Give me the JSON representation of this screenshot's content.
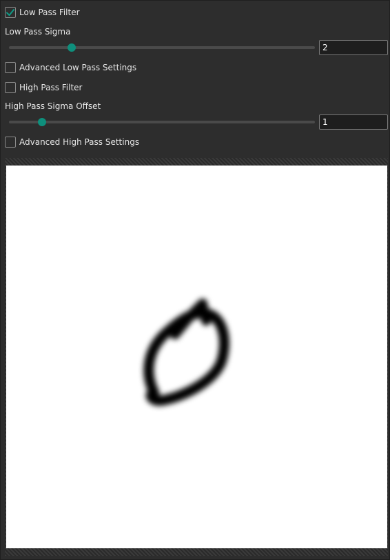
{
  "low_pass": {
    "enabled": true,
    "label": "Low Pass Filter",
    "sigma_label": "Low Pass Sigma",
    "sigma_value": "2",
    "slider_fraction": 0.2,
    "advanced_label": "Advanced Low Pass Settings",
    "advanced_enabled": false
  },
  "high_pass": {
    "enabled": false,
    "label": "High Pass Filter",
    "offset_label": "High Pass Sigma Offset",
    "offset_value": "1",
    "slider_fraction": 0.1,
    "advanced_label": "Advanced High Pass Settings",
    "advanced_enabled": false
  },
  "colors": {
    "accent": "#0e8f7c",
    "background": "#2d2d2d",
    "preview": "#ffffff"
  },
  "icons": {
    "check": "checkmark-icon"
  }
}
